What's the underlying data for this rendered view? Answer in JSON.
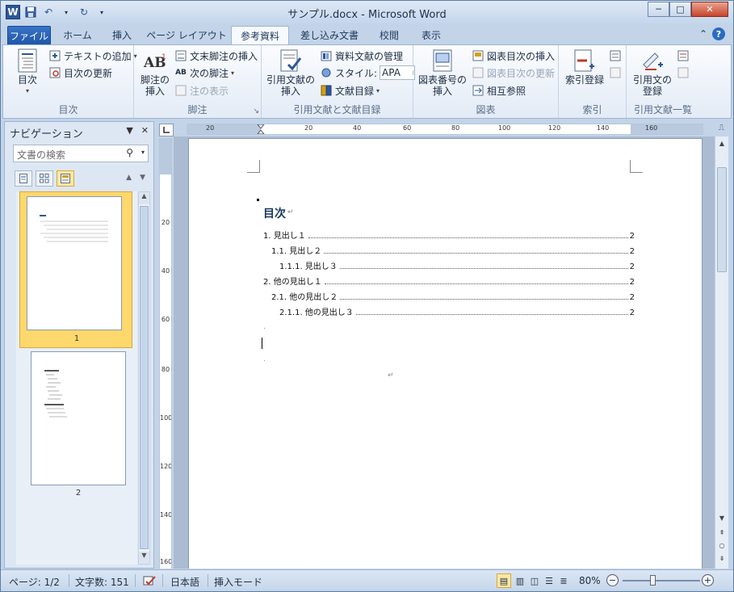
{
  "window": {
    "title": "サンプル.docx - Microsoft Word",
    "minimize": "─",
    "maximize": "□",
    "close": "✕"
  },
  "qat": {
    "app_icon": "W",
    "save_icon": "save-icon",
    "undo_icon": "undo-icon",
    "redo_icon": "redo-icon",
    "customize_icon": "dropdown-icon"
  },
  "tabs": [
    {
      "label": "ファイル"
    },
    {
      "label": "ホーム"
    },
    {
      "label": "挿入"
    },
    {
      "label": "ページ レイアウト"
    },
    {
      "label": "参考資料"
    },
    {
      "label": "差し込み文書"
    },
    {
      "label": "校閲"
    },
    {
      "label": "表示"
    }
  ],
  "tab_right": {
    "collapse": "⌃",
    "help": "?"
  },
  "ribbon": {
    "toc_group": {
      "label": "目次",
      "toc_button": "目次",
      "add_text": "テキストの追加",
      "update_toc": "目次の更新"
    },
    "footnote_group": {
      "label": "脚注",
      "insert_footnote_line1": "脚注の",
      "insert_footnote_line2": "挿入",
      "insert_endnote": "文末脚注の挿入",
      "next_footnote": "次の脚注",
      "show_notes": "注の表示"
    },
    "citation_group": {
      "label": "引用文献と文献目録",
      "insert_citation_line1": "引用文献の",
      "insert_citation_line2": "挿入",
      "manage_sources": "資料文献の管理",
      "style_label": "スタイル:",
      "style_value": "APA",
      "bibliography": "文献目録"
    },
    "captions_group": {
      "label": "図表",
      "insert_caption_line1": "図表番号の",
      "insert_caption_line2": "挿入",
      "insert_tof": "図表目次の挿入",
      "update_table": "図表目次の更新",
      "cross_reference": "相互参照"
    },
    "index_group": {
      "label": "索引",
      "mark_entry": "索引登録"
    },
    "toa_group": {
      "label": "引用文献一覧",
      "mark_citation_line1": "引用文の",
      "mark_citation_line2": "登録"
    }
  },
  "nav": {
    "title": "ナビゲーション",
    "search_placeholder": "文書の検索",
    "pages": [
      {
        "number": "1"
      },
      {
        "number": "2"
      }
    ]
  },
  "ruler": {
    "h_ticks": [
      "20",
      "20",
      "40",
      "60",
      "80",
      "100",
      "120",
      "140",
      "160"
    ],
    "v_ticks": [
      "20",
      "40",
      "60",
      "80",
      "100",
      "120",
      "140",
      "160"
    ]
  },
  "document": {
    "toc_title": "目次",
    "toc_entries": [
      {
        "text": "1. 見出し１",
        "page": "2"
      },
      {
        "text": "1.1. 見出し２",
        "page": "2"
      },
      {
        "text": "1.1.1. 見出し３",
        "page": "2"
      },
      {
        "text": "2. 他の見出し１",
        "page": "2"
      },
      {
        "text": "2.1. 他の見出し２",
        "page": "2"
      },
      {
        "text": "2.1.1. 他の見出し３",
        "page": "2"
      }
    ]
  },
  "status": {
    "page": "ページ: 1/2",
    "words": "文字数: 151",
    "language": "日本語",
    "mode": "挿入モード",
    "zoom": "80%"
  }
}
